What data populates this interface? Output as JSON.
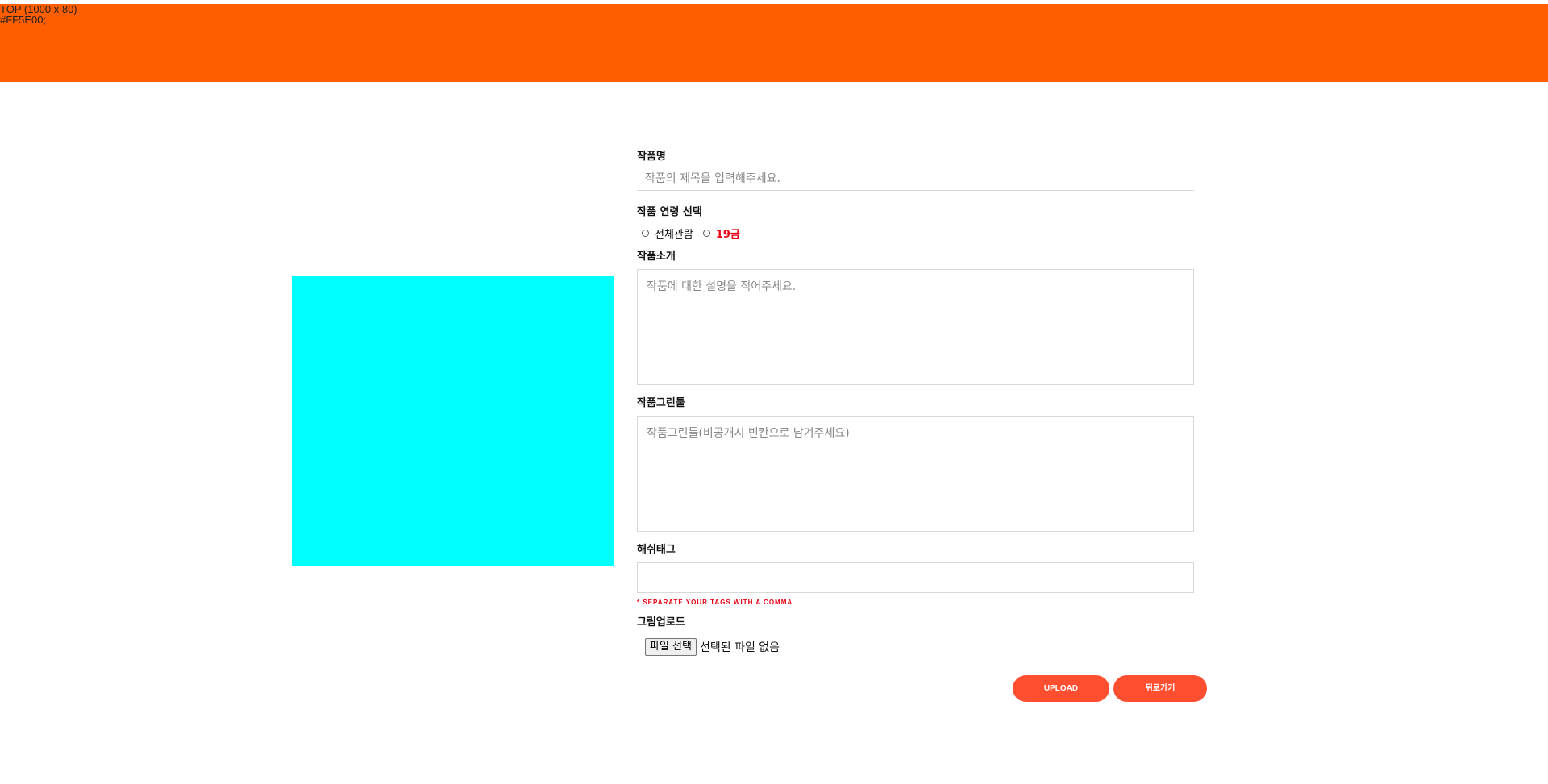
{
  "colors": {
    "top_bar": "#FF5E00",
    "preview": "#00FFFF",
    "button": "#FF4F30",
    "warning_red": "#E60012"
  },
  "top": {
    "label_line1": "TOP (1000 x 80)",
    "label_line2": "#FF5E00;"
  },
  "form": {
    "title_label": "작품명",
    "title_placeholder": "작품의 제목을 입력해주세요.",
    "age_label": "작품 연령 선택",
    "age_options": [
      "전체관람",
      "19금"
    ],
    "intro_label": "작품소개",
    "intro_placeholder": "작품에 대한 설명을 적어주세요.",
    "tools_label": "작품그린툴",
    "tools_placeholder": "작품그린툴(비공개시 빈칸으로 남겨주세요)",
    "hashtag_label": "해쉬태그",
    "hashtag_hint": "* SEPARATE YOUR TAGS WITH A COMMA",
    "upload_label": "그림업로드",
    "file_button": "파일 선택",
    "file_status": "선택된 파일 없음"
  },
  "buttons": {
    "upload": "UPLOAD",
    "back": "뒤로가기"
  }
}
